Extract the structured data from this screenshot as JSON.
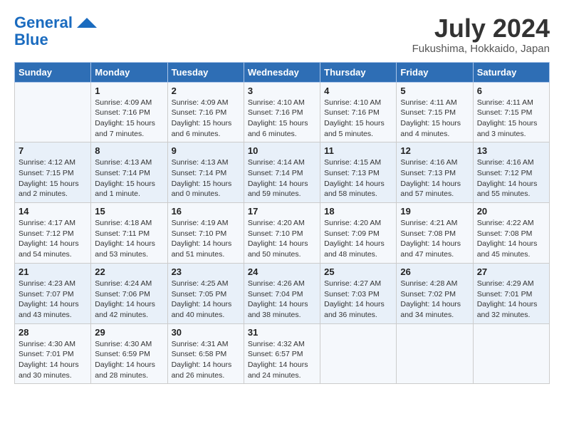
{
  "header": {
    "logo_line1": "General",
    "logo_line2": "Blue",
    "month_year": "July 2024",
    "location": "Fukushima, Hokkaido, Japan"
  },
  "weekdays": [
    "Sunday",
    "Monday",
    "Tuesday",
    "Wednesday",
    "Thursday",
    "Friday",
    "Saturday"
  ],
  "weeks": [
    [
      {
        "day": "",
        "info": ""
      },
      {
        "day": "1",
        "info": "Sunrise: 4:09 AM\nSunset: 7:16 PM\nDaylight: 15 hours\nand 7 minutes."
      },
      {
        "day": "2",
        "info": "Sunrise: 4:09 AM\nSunset: 7:16 PM\nDaylight: 15 hours\nand 6 minutes."
      },
      {
        "day": "3",
        "info": "Sunrise: 4:10 AM\nSunset: 7:16 PM\nDaylight: 15 hours\nand 6 minutes."
      },
      {
        "day": "4",
        "info": "Sunrise: 4:10 AM\nSunset: 7:16 PM\nDaylight: 15 hours\nand 5 minutes."
      },
      {
        "day": "5",
        "info": "Sunrise: 4:11 AM\nSunset: 7:15 PM\nDaylight: 15 hours\nand 4 minutes."
      },
      {
        "day": "6",
        "info": "Sunrise: 4:11 AM\nSunset: 7:15 PM\nDaylight: 15 hours\nand 3 minutes."
      }
    ],
    [
      {
        "day": "7",
        "info": "Sunrise: 4:12 AM\nSunset: 7:15 PM\nDaylight: 15 hours\nand 2 minutes."
      },
      {
        "day": "8",
        "info": "Sunrise: 4:13 AM\nSunset: 7:14 PM\nDaylight: 15 hours\nand 1 minute."
      },
      {
        "day": "9",
        "info": "Sunrise: 4:13 AM\nSunset: 7:14 PM\nDaylight: 15 hours\nand 0 minutes."
      },
      {
        "day": "10",
        "info": "Sunrise: 4:14 AM\nSunset: 7:14 PM\nDaylight: 14 hours\nand 59 minutes."
      },
      {
        "day": "11",
        "info": "Sunrise: 4:15 AM\nSunset: 7:13 PM\nDaylight: 14 hours\nand 58 minutes."
      },
      {
        "day": "12",
        "info": "Sunrise: 4:16 AM\nSunset: 7:13 PM\nDaylight: 14 hours\nand 57 minutes."
      },
      {
        "day": "13",
        "info": "Sunrise: 4:16 AM\nSunset: 7:12 PM\nDaylight: 14 hours\nand 55 minutes."
      }
    ],
    [
      {
        "day": "14",
        "info": "Sunrise: 4:17 AM\nSunset: 7:12 PM\nDaylight: 14 hours\nand 54 minutes."
      },
      {
        "day": "15",
        "info": "Sunrise: 4:18 AM\nSunset: 7:11 PM\nDaylight: 14 hours\nand 53 minutes."
      },
      {
        "day": "16",
        "info": "Sunrise: 4:19 AM\nSunset: 7:10 PM\nDaylight: 14 hours\nand 51 minutes."
      },
      {
        "day": "17",
        "info": "Sunrise: 4:20 AM\nSunset: 7:10 PM\nDaylight: 14 hours\nand 50 minutes."
      },
      {
        "day": "18",
        "info": "Sunrise: 4:20 AM\nSunset: 7:09 PM\nDaylight: 14 hours\nand 48 minutes."
      },
      {
        "day": "19",
        "info": "Sunrise: 4:21 AM\nSunset: 7:08 PM\nDaylight: 14 hours\nand 47 minutes."
      },
      {
        "day": "20",
        "info": "Sunrise: 4:22 AM\nSunset: 7:08 PM\nDaylight: 14 hours\nand 45 minutes."
      }
    ],
    [
      {
        "day": "21",
        "info": "Sunrise: 4:23 AM\nSunset: 7:07 PM\nDaylight: 14 hours\nand 43 minutes."
      },
      {
        "day": "22",
        "info": "Sunrise: 4:24 AM\nSunset: 7:06 PM\nDaylight: 14 hours\nand 42 minutes."
      },
      {
        "day": "23",
        "info": "Sunrise: 4:25 AM\nSunset: 7:05 PM\nDaylight: 14 hours\nand 40 minutes."
      },
      {
        "day": "24",
        "info": "Sunrise: 4:26 AM\nSunset: 7:04 PM\nDaylight: 14 hours\nand 38 minutes."
      },
      {
        "day": "25",
        "info": "Sunrise: 4:27 AM\nSunset: 7:03 PM\nDaylight: 14 hours\nand 36 minutes."
      },
      {
        "day": "26",
        "info": "Sunrise: 4:28 AM\nSunset: 7:02 PM\nDaylight: 14 hours\nand 34 minutes."
      },
      {
        "day": "27",
        "info": "Sunrise: 4:29 AM\nSunset: 7:01 PM\nDaylight: 14 hours\nand 32 minutes."
      }
    ],
    [
      {
        "day": "28",
        "info": "Sunrise: 4:30 AM\nSunset: 7:01 PM\nDaylight: 14 hours\nand 30 minutes."
      },
      {
        "day": "29",
        "info": "Sunrise: 4:30 AM\nSunset: 6:59 PM\nDaylight: 14 hours\nand 28 minutes."
      },
      {
        "day": "30",
        "info": "Sunrise: 4:31 AM\nSunset: 6:58 PM\nDaylight: 14 hours\nand 26 minutes."
      },
      {
        "day": "31",
        "info": "Sunrise: 4:32 AM\nSunset: 6:57 PM\nDaylight: 14 hours\nand 24 minutes."
      },
      {
        "day": "",
        "info": ""
      },
      {
        "day": "",
        "info": ""
      },
      {
        "day": "",
        "info": ""
      }
    ]
  ]
}
